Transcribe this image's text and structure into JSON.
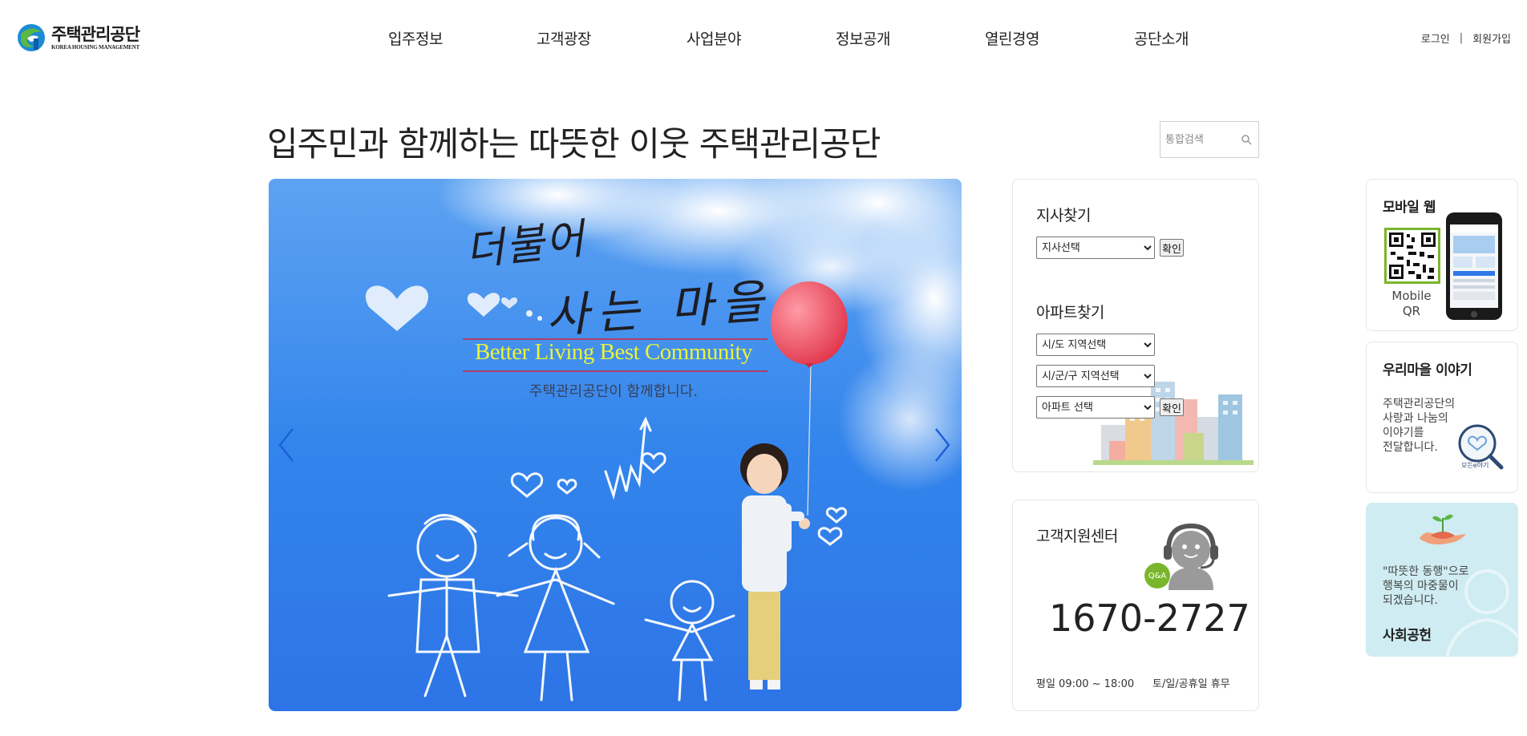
{
  "header": {
    "logo_ko": "주택관리공단",
    "logo_en": "KOREA HOUSING MANAGEMENT",
    "nav": [
      "입주정보",
      "고객광장",
      "사업분야",
      "정보공개",
      "열린경영",
      "공단소개"
    ],
    "login": "로그인",
    "separator": "|",
    "signup": "회원가입"
  },
  "main": {
    "title": "입주민과 함께하는 따뜻한 이웃 주택관리공단",
    "search_placeholder": "통합검색"
  },
  "slider": {
    "calligraphy_line1": "더불어",
    "calligraphy_line2": "사는 마을",
    "slogan_en": "Better Living Best Community",
    "slogan_ko": "주택관리공단이  함께합니다."
  },
  "branch_finder": {
    "title": "지사찾기",
    "select_value": "지사선택",
    "confirm": "확인"
  },
  "apt_finder": {
    "title": "아파트찾기",
    "select_city": "시/도 지역선택",
    "select_district": "시/군/구 지역선택",
    "select_apt": "아파트 선택",
    "confirm": "확인"
  },
  "support": {
    "title": "고객지원센터",
    "qa_badge": "Q&A",
    "phone": "1670-2727",
    "weekday_hours": "평일 09:00 ~ 18:00",
    "holiday": "토/일/공휴일 휴무"
  },
  "mobile_web": {
    "title": "모바일 웹",
    "qr_label_1": "Mobile",
    "qr_label_2": "QR"
  },
  "village_story": {
    "title": "우리마을 이야기",
    "text_lines": [
      "주택관리공단의",
      "사랑과 나눔의",
      "이야기를",
      "전달합니다."
    ],
    "badge": "모든e야기"
  },
  "social": {
    "text_lines": [
      "\"따뜻한 동행\"으로",
      "행복의 마중물이",
      "되겠습니다."
    ],
    "title": "사회공헌"
  },
  "colors": {
    "sky_blue": "#2f78e8",
    "slogan_yellow": "#e9f33a",
    "social_bg": "#cfecf2",
    "qa_green": "#7ab62b"
  }
}
